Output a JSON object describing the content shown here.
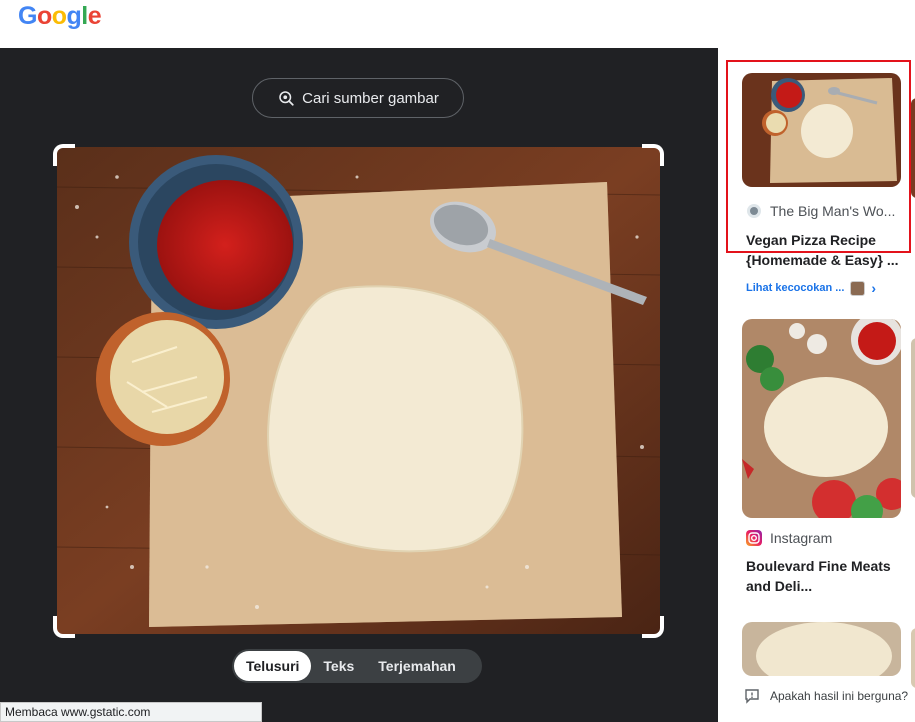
{
  "header": {
    "logo": [
      "G",
      "o",
      "o",
      "g",
      "l",
      "e"
    ]
  },
  "left": {
    "source_button": "Cari sumber gambar",
    "tabs": [
      "Telusuri",
      "Teks",
      "Terjemahan"
    ]
  },
  "status": "Membaca www.gstatic.com",
  "results": [
    {
      "site": "The Big Man's Wo...",
      "title": "Vegan Pizza Recipe {Homemade & Easy} ...",
      "match_link": "Lihat kecocokan ..."
    },
    {
      "site": "Instagram",
      "title": "Boulevard Fine Meats and Deli..."
    }
  ],
  "feedback": "Apakah hasil ini berguna?",
  "colors": {
    "dark_bg": "#202124",
    "highlight": "#e3121b",
    "link": "#1a73e8"
  }
}
